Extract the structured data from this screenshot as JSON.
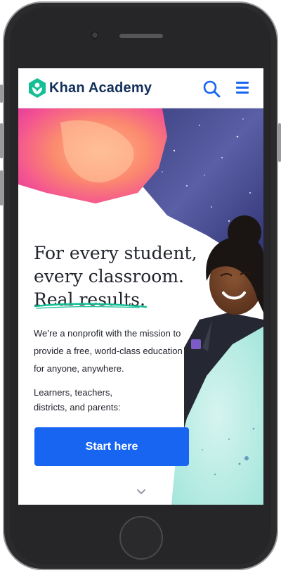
{
  "nav": {
    "brand": "Khan Academy",
    "logo_icon": "khan-academy-hexagon-logo",
    "search_icon": "search-icon",
    "menu_icon": "hamburger-menu-icon"
  },
  "hero": {
    "headline_line1": "For every student,",
    "headline_line2": "every classroom.",
    "headline_line3": "Real results.",
    "mission": "We’re a nonprofit with the mission to provide a free, world-class education for anyone, anywhere.",
    "audience": "Learners, teachers, districts, and parents:",
    "cta_label": "Start here",
    "scroll_icon": "chevron-down-icon"
  },
  "colors": {
    "brand_navy": "#14305a",
    "brand_green": "#14bf96",
    "action_blue": "#1865f2",
    "text": "#21242c"
  }
}
